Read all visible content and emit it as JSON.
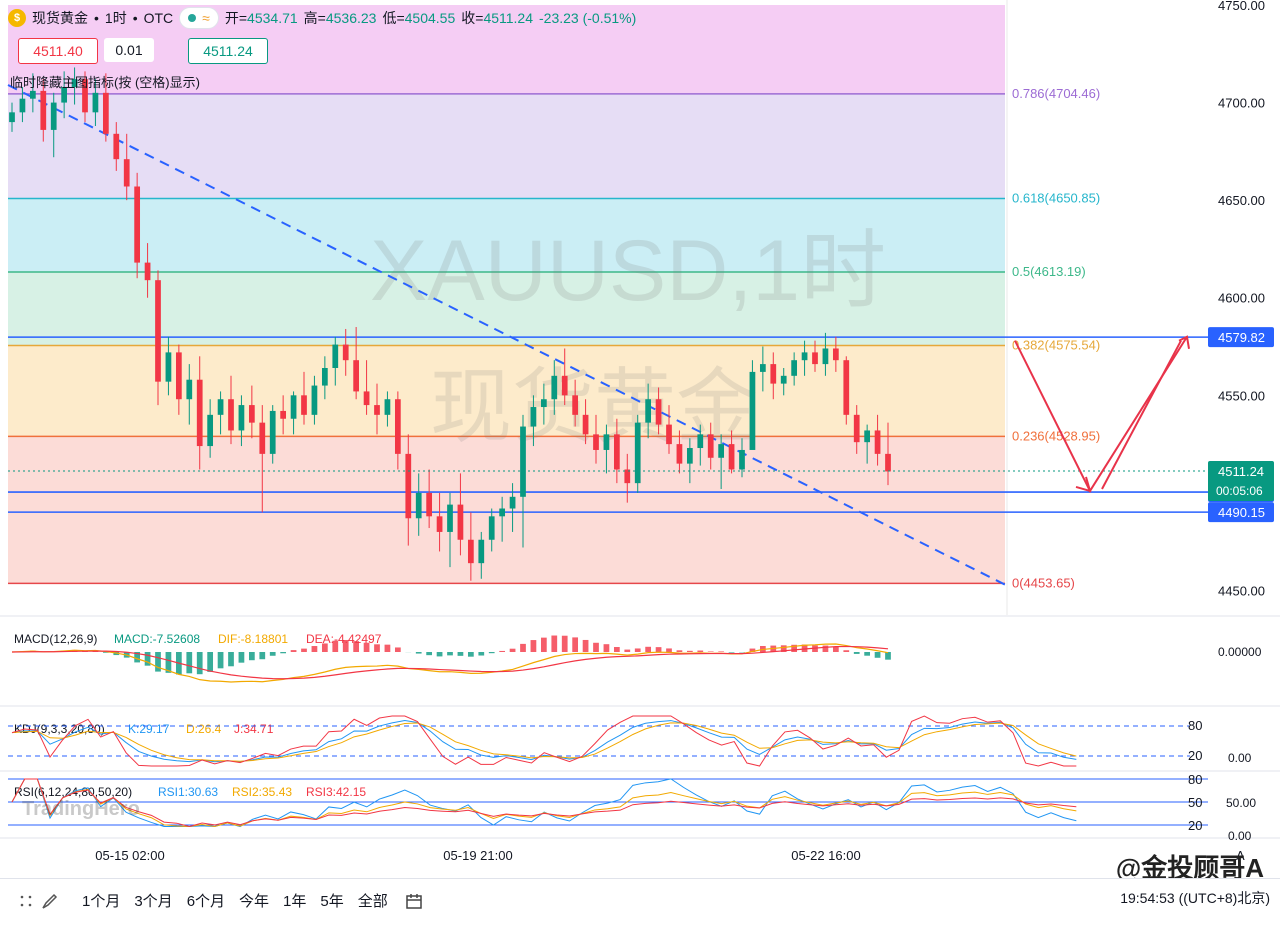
{
  "header": {
    "symbol": "现货黄金",
    "timeframe": "1时",
    "exchange": "OTC",
    "coin_glyph": "$",
    "approx_glyph": "≈",
    "open_label": "开=",
    "open": "4534.71",
    "high_label": "高=",
    "high": "4536.23",
    "low_label": "低=",
    "low": "4504.55",
    "close_label": "收=",
    "close": "4511.24",
    "change": "-23.23 (-0.51%)"
  },
  "sell_price": "4511.40",
  "spread": "0.01",
  "buy_price": "4511.24",
  "hint": "临时降藏主图指标(按 (空格)显示)",
  "watermark": {
    "line1": "XAUUSD,1时",
    "line2": "现货黄金",
    "logo": "TradingHero"
  },
  "colors": {
    "up": "#089981",
    "down": "#f23645",
    "accent": "#2962ff",
    "red_arrow": "#e8334a"
  },
  "chart_data": {
    "type": "candlestick",
    "symbol": "XAUUSD",
    "ylim": [
      4440,
      4750
    ],
    "y_ticks": [
      4450,
      4500,
      4550,
      4600,
      4650,
      4700,
      4750
    ],
    "y_tick_labels": [
      "4450.00",
      "4500.00",
      "4550.00",
      "4600.00",
      "4650.00",
      "4700.00",
      "4750.00"
    ],
    "x_tick_labels": [
      "05-15 02:00",
      "05-19 21:00",
      "05-22 16:00"
    ],
    "fib_levels": [
      {
        "ratio": 1.0,
        "price": 4750,
        "label": "",
        "fill": "#f3c4f2"
      },
      {
        "ratio": 0.786,
        "price": 4704.46,
        "label": "0.786(4704.46)",
        "line": "#9c6bd4",
        "fill": "#e2d7f3"
      },
      {
        "ratio": 0.618,
        "price": 4650.85,
        "label": "0.618(4650.85)",
        "line": "#26b6cc",
        "fill": "#c2ebf3"
      },
      {
        "ratio": 0.5,
        "price": 4613.19,
        "label": "0.5(4613.19)",
        "line": "#3db88a",
        "fill": "#d0efe0"
      },
      {
        "ratio": 0.382,
        "price": 4575.54,
        "label": "0.382(4575.54)",
        "line": "#e6a83a",
        "fill": "#fde8c2"
      },
      {
        "ratio": 0.236,
        "price": 4528.95,
        "label": "0.236(4528.95)",
        "line": "#f0703c",
        "fill": "#fcd6d0"
      },
      {
        "ratio": 0,
        "price": 4453.65,
        "label": "0(4453.65)",
        "line": "#e6474a"
      }
    ],
    "horizontal_levels": [
      {
        "price": 4579.82,
        "label": "4579.82"
      },
      {
        "price": 4500.44,
        "label": "4500.44"
      },
      {
        "price": 4490.15,
        "label": "4490.15"
      }
    ],
    "last_price": {
      "price": 4511.24,
      "label": "4511.24",
      "countdown": "00:05:06"
    },
    "trendline": {
      "from": [
        0.0,
        4709
      ],
      "to": [
        1.0,
        4453
      ]
    },
    "candles": [
      [
        4690,
        4700,
        4685,
        4695
      ],
      [
        4695,
        4708,
        4690,
        4702
      ],
      [
        4702,
        4715,
        4695,
        4706
      ],
      [
        4706,
        4712,
        4680,
        4686
      ],
      [
        4686,
        4705,
        4672,
        4700
      ],
      [
        4700,
        4716,
        4692,
        4708
      ],
      [
        4708,
        4718,
        4699,
        4712
      ],
      [
        4712,
        4716,
        4690,
        4695
      ],
      [
        4695,
        4712,
        4688,
        4705
      ],
      [
        4705,
        4715,
        4680,
        4684
      ],
      [
        4684,
        4690,
        4665,
        4671
      ],
      [
        4671,
        4684,
        4650,
        4657
      ],
      [
        4657,
        4664,
        4610,
        4618
      ],
      [
        4618,
        4628,
        4600,
        4609
      ],
      [
        4609,
        4614,
        4545,
        4557
      ],
      [
        4557,
        4580,
        4550,
        4572
      ],
      [
        4572,
        4576,
        4540,
        4548
      ],
      [
        4548,
        4566,
        4535,
        4558
      ],
      [
        4558,
        4570,
        4512,
        4524
      ],
      [
        4524,
        4548,
        4518,
        4540
      ],
      [
        4540,
        4552,
        4530,
        4548
      ],
      [
        4548,
        4560,
        4525,
        4532
      ],
      [
        4532,
        4550,
        4524,
        4545
      ],
      [
        4545,
        4555,
        4528,
        4536
      ],
      [
        4536,
        4545,
        4490,
        4520
      ],
      [
        4520,
        4545,
        4515,
        4542
      ],
      [
        4542,
        4550,
        4530,
        4538
      ],
      [
        4538,
        4552,
        4530,
        4550
      ],
      [
        4550,
        4562,
        4535,
        4540
      ],
      [
        4540,
        4560,
        4535,
        4555
      ],
      [
        4555,
        4570,
        4548,
        4564
      ],
      [
        4564,
        4580,
        4555,
        4576
      ],
      [
        4576,
        4584,
        4560,
        4568
      ],
      [
        4568,
        4585,
        4548,
        4552
      ],
      [
        4552,
        4568,
        4540,
        4545
      ],
      [
        4545,
        4556,
        4530,
        4540
      ],
      [
        4540,
        4552,
        4534,
        4548
      ],
      [
        4548,
        4552,
        4512,
        4520
      ],
      [
        4520,
        4530,
        4473,
        4487
      ],
      [
        4487,
        4510,
        4478,
        4500
      ],
      [
        4500,
        4512,
        4482,
        4488
      ],
      [
        4488,
        4500,
        4470,
        4480
      ],
      [
        4480,
        4500,
        4462,
        4494
      ],
      [
        4494,
        4510,
        4468,
        4476
      ],
      [
        4476,
        4490,
        4455,
        4464
      ],
      [
        4464,
        4480,
        4456,
        4476
      ],
      [
        4476,
        4492,
        4470,
        4488
      ],
      [
        4488,
        4498,
        4475,
        4492
      ],
      [
        4492,
        4505,
        4480,
        4498
      ],
      [
        4498,
        4540,
        4472,
        4534
      ],
      [
        4534,
        4550,
        4524,
        4544
      ],
      [
        4544,
        4556,
        4535,
        4548
      ],
      [
        4548,
        4568,
        4540,
        4560
      ],
      [
        4560,
        4574,
        4545,
        4550
      ],
      [
        4550,
        4558,
        4534,
        4540
      ],
      [
        4540,
        4548,
        4525,
        4530
      ],
      [
        4530,
        4540,
        4515,
        4522
      ],
      [
        4522,
        4535,
        4510,
        4530
      ],
      [
        4530,
        4538,
        4505,
        4512
      ],
      [
        4512,
        4520,
        4495,
        4505
      ],
      [
        4505,
        4540,
        4500,
        4536
      ],
      [
        4536,
        4556,
        4528,
        4548
      ],
      [
        4548,
        4554,
        4530,
        4535
      ],
      [
        4535,
        4545,
        4520,
        4525
      ],
      [
        4525,
        4532,
        4510,
        4515
      ],
      [
        4515,
        4528,
        4505,
        4523
      ],
      [
        4523,
        4535,
        4514,
        4530
      ],
      [
        4530,
        4536,
        4512,
        4518
      ],
      [
        4518,
        4530,
        4502,
        4525
      ],
      [
        4525,
        4532,
        4510,
        4512
      ],
      [
        4512,
        4528,
        4508,
        4522
      ],
      [
        4522,
        4568,
        4542,
        4562
      ],
      [
        4562,
        4575,
        4552,
        4566
      ],
      [
        4566,
        4572,
        4548,
        4556
      ],
      [
        4556,
        4564,
        4550,
        4560
      ],
      [
        4560,
        4572,
        4555,
        4568
      ],
      [
        4568,
        4578,
        4560,
        4572
      ],
      [
        4572,
        4578,
        4562,
        4566
      ],
      [
        4566,
        4582,
        4560,
        4574
      ],
      [
        4574,
        4580,
        4562,
        4568
      ],
      [
        4568,
        4570,
        4535,
        4540
      ],
      [
        4540,
        4545,
        4520,
        4526
      ],
      [
        4526,
        4535,
        4515,
        4532
      ],
      [
        4532,
        4540,
        4514,
        4520
      ],
      [
        4520,
        4536,
        4504,
        4511
      ]
    ]
  },
  "indicators": {
    "macd": {
      "label": "MACD(12,26,9)",
      "macd": "MACD:-7.52608",
      "dif": "DIF:-8.18801",
      "dea": "DEA:-4.42497",
      "axis": "0.00000"
    },
    "kdj": {
      "label": "KDJ(9,3,3,20,80)",
      "k": "K:29.17",
      "d": "D:26.4",
      "j": "J:34.71",
      "level_80": "80",
      "level_20": "20",
      "axis": "0.00"
    },
    "rsi": {
      "label": "RSI(6,12,24,80,50,20)",
      "rsi1": "RSI1:30.63",
      "rsi2": "RSI2:35.43",
      "rsi3": "RSI3:42.15",
      "level_80": "80",
      "level_50": "50",
      "level_20": "20",
      "axis_50": "50.00",
      "axis_0": "0.00"
    }
  },
  "bottom_bar": {
    "ranges": [
      "1个月",
      "3个月",
      "6个月",
      "今年",
      "1年",
      "5年",
      "全部"
    ],
    "clock": "19:54:53 ((UTC+8)北京)"
  },
  "credit": "@金投顾哥A",
  "auto_label": "A"
}
